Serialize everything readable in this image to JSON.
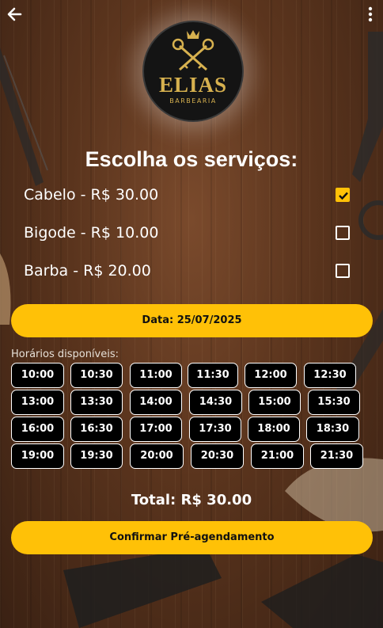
{
  "header": {
    "back_icon": "arrow-left-icon",
    "menu_icon": "more-vertical-icon"
  },
  "logo": {
    "name": "ELIAS",
    "subtitle": "BARBEARIA",
    "gold": "#d7b14f"
  },
  "title": "Escolha os serviços:",
  "services": [
    {
      "label": "Cabelo - R$ 30.00",
      "checked": true
    },
    {
      "label": "Bigode - R$ 10.00",
      "checked": false
    },
    {
      "label": "Barba - R$ 20.00",
      "checked": false
    }
  ],
  "date_button": "Data: 25/07/2025",
  "slots_label": "Horários disponíveis:",
  "slots": [
    "10:00",
    "10:30",
    "11:00",
    "11:30",
    "12:00",
    "12:30",
    "13:00",
    "13:30",
    "14:00",
    "14:30",
    "15:00",
    "15:30",
    "16:00",
    "16:30",
    "17:00",
    "17:30",
    "18:00",
    "18:30",
    "19:00",
    "19:30",
    "20:00",
    "20:30",
    "21:00",
    "21:30"
  ],
  "total": "Total: R$ 30.00",
  "confirm_button": "Confirmar Pré-agendamento",
  "colors": {
    "accent": "#ffc107",
    "slot_bg": "#000000"
  }
}
